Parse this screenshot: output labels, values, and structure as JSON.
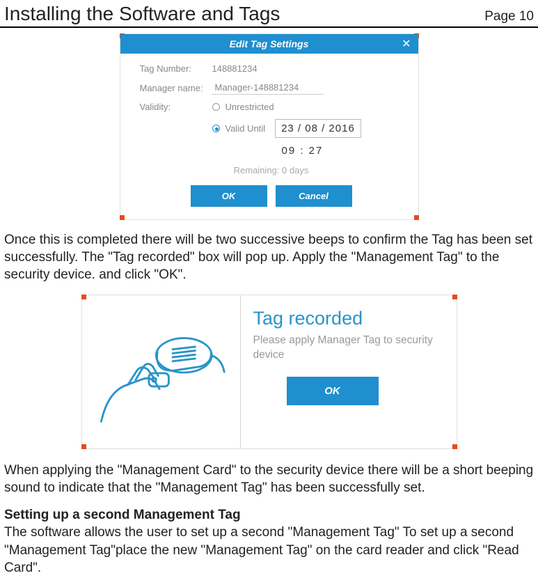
{
  "header": {
    "title": "Installing the Software and Tags",
    "page": "Page 10"
  },
  "dialog1": {
    "title": "Edit Tag Settings",
    "fields": {
      "tag_number_label": "Tag Number:",
      "tag_number_value": "148881234",
      "manager_label": "Manager name:",
      "manager_value": "Manager-148881234",
      "validity_label": "Validity:",
      "opt_unrestricted": "Unrestricted",
      "opt_valid_until": "Valid Until",
      "date": "23  /  08  /  2016",
      "time": "09  :  27",
      "remaining": "Remaining: 0 days"
    },
    "buttons": {
      "ok": "OK",
      "cancel": "Cancel"
    }
  },
  "paragraph1": "Once this is completed there will be two successive beeps to confirm the Tag has been set successfully. The \"Tag recorded\" box will pop up. Apply the \"Management Tag\" to the security device. and click \"OK\".",
  "dialog2": {
    "title": "Tag recorded",
    "subtitle": "Please apply Manager Tag to security device",
    "ok": "OK"
  },
  "paragraph2": "When applying the \"Management Card\" to the security device there will be a short beeping sound to indicate that the \"Management Tag\" has been successfully set.",
  "heading2": "Setting up a second Management Tag",
  "paragraph3": "The software allows the user to set up a second \"Management Tag\" To set up a second \"Management Tag\"place the new \"Management Tag\" on the card reader and click \"Read Card\"."
}
